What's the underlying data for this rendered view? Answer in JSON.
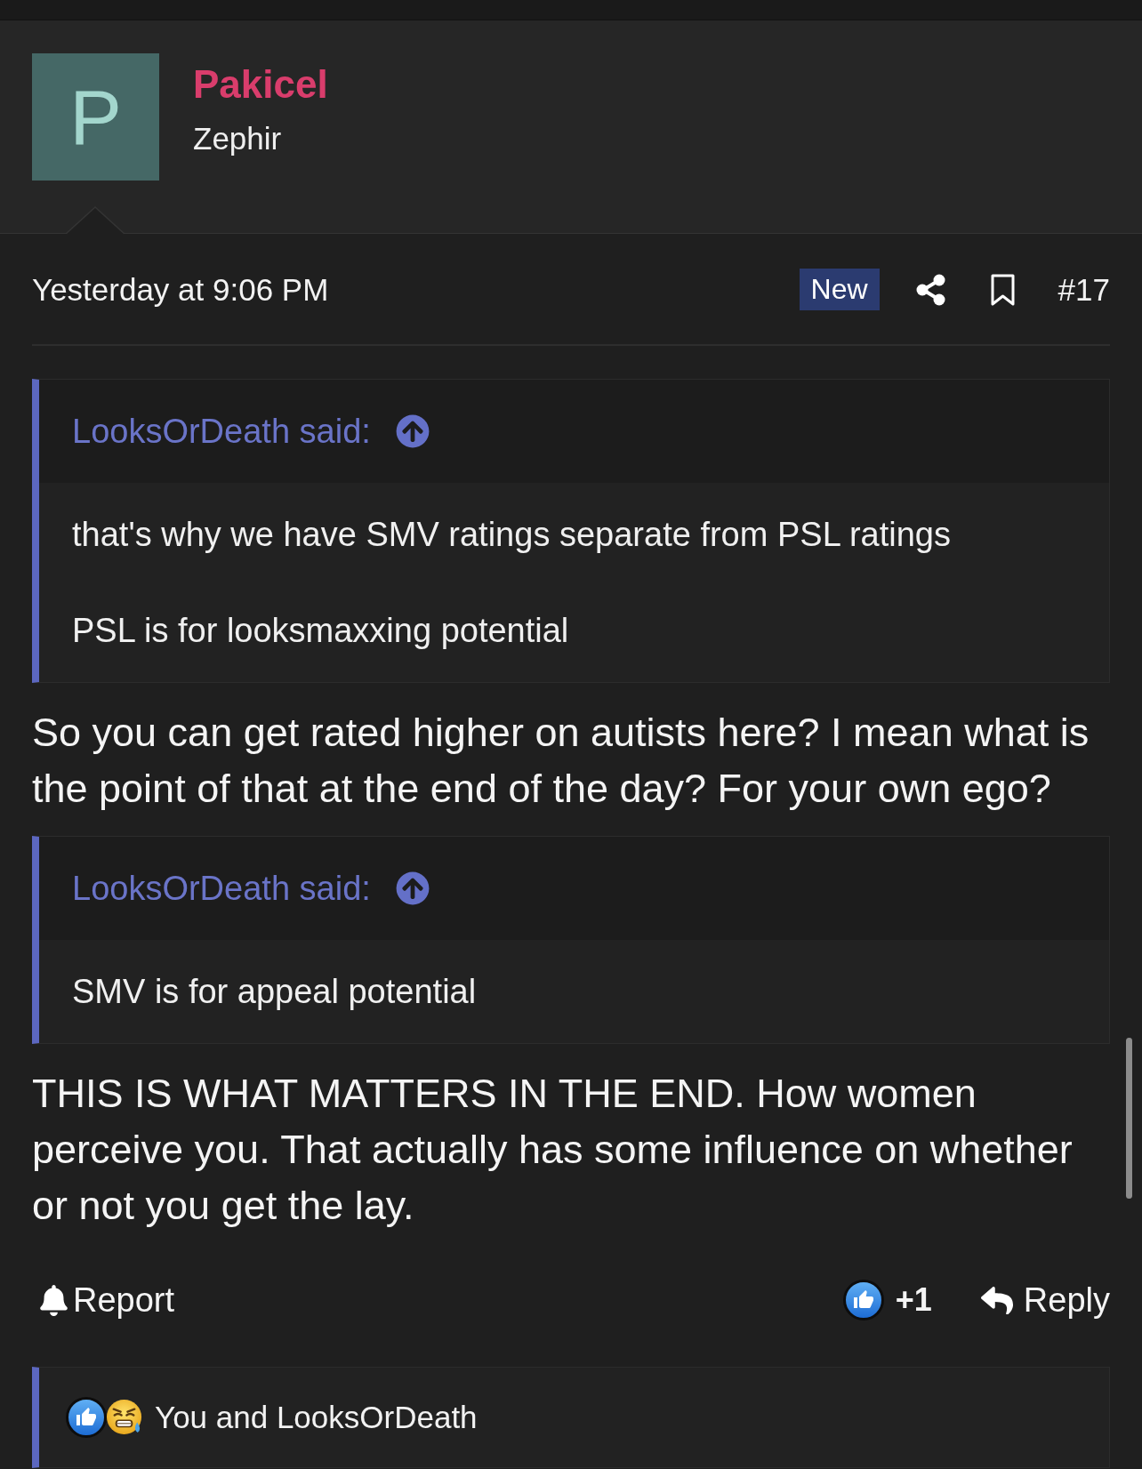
{
  "author": {
    "avatar_letter": "P",
    "name": "Pakicel",
    "title": "Zephir"
  },
  "post": {
    "time": "Yesterday at 9:06 PM",
    "badge": "New",
    "number": "#17"
  },
  "content": [
    {
      "kind": "quote",
      "source": "LooksOrDeath said:",
      "paragraphs": [
        "that's why we have SMV ratings separate from PSL ratings",
        "PSL is for looksmaxxing potential"
      ]
    },
    {
      "kind": "text",
      "text": "So you can get rated higher on autists here? I mean what is the point of that at the end of the day? For your own ego?"
    },
    {
      "kind": "quote",
      "source": "LooksOrDeath said:",
      "paragraphs": [
        "SMV is for appeal potential"
      ]
    },
    {
      "kind": "text",
      "text": "THIS IS WHAT MATTERS IN THE END. How women perceive you. That actually has some influence on whether or not you get the lay."
    }
  ],
  "actions": {
    "report": "Report",
    "reaction": "+1",
    "reply": "Reply"
  },
  "reactions": {
    "summary": "You and LooksOrDeath"
  }
}
